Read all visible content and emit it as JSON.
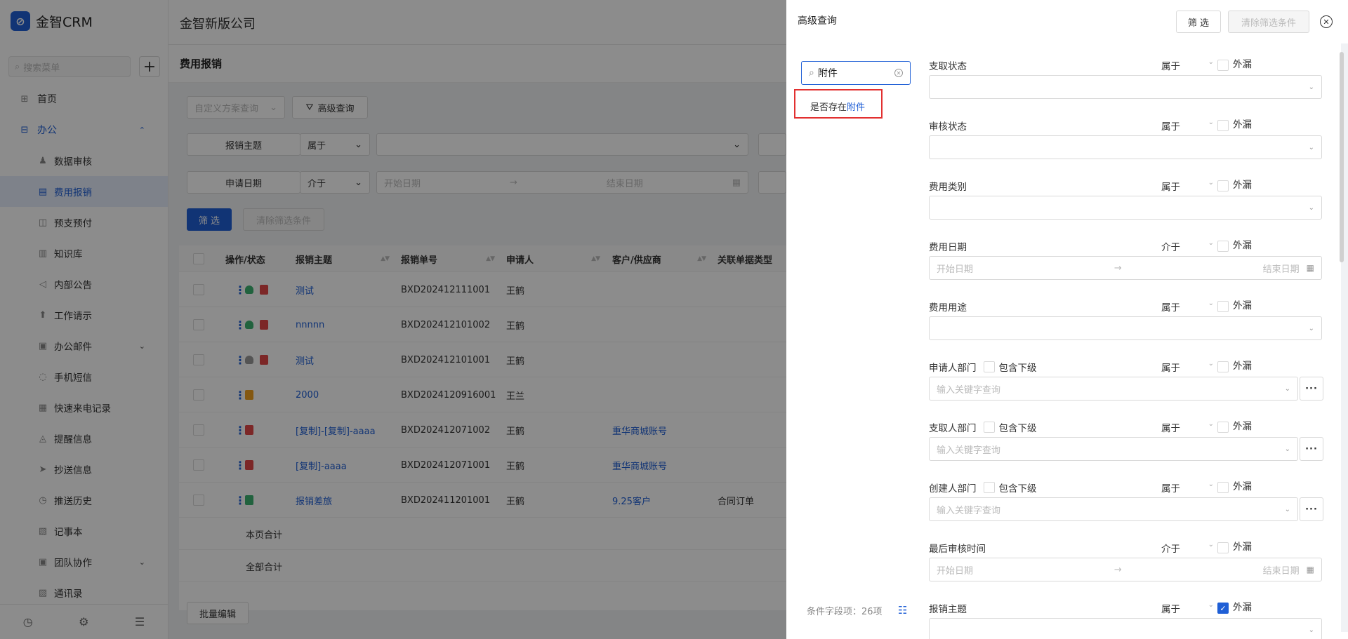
{
  "app": {
    "brand": "金智CRM",
    "company": "金智新版公司"
  },
  "sidebar": {
    "search_placeholder": "搜索菜单",
    "add_label": "+",
    "items": [
      {
        "label": "首页",
        "icon": "home-icon",
        "glyph": "⊞"
      },
      {
        "label": "办公",
        "icon": "office-icon",
        "glyph": "⊟"
      },
      {
        "label": "数据审核",
        "icon": "user-icon",
        "glyph": "♟"
      },
      {
        "label": "费用报销",
        "icon": "receipt-icon",
        "glyph": "▤"
      },
      {
        "label": "预支预付",
        "icon": "wallet-icon",
        "glyph": "◫"
      },
      {
        "label": "知识库",
        "icon": "book-icon",
        "glyph": "▥"
      },
      {
        "label": "内部公告",
        "icon": "megaphone-icon",
        "glyph": "◁"
      },
      {
        "label": "工作请示",
        "icon": "upload-icon",
        "glyph": "⬆"
      },
      {
        "label": "办公邮件",
        "icon": "mail-icon",
        "glyph": "▣"
      },
      {
        "label": "手机短信",
        "icon": "message-icon",
        "glyph": "◌"
      },
      {
        "label": "快速来电记录",
        "icon": "call-log-icon",
        "glyph": "▦"
      },
      {
        "label": "提醒信息",
        "icon": "bell-icon",
        "glyph": "◬"
      },
      {
        "label": "抄送信息",
        "icon": "send-icon",
        "glyph": "➤"
      },
      {
        "label": "推送历史",
        "icon": "clock-icon",
        "glyph": "◷"
      },
      {
        "label": "记事本",
        "icon": "notebook-icon",
        "glyph": "▧"
      },
      {
        "label": "团队协作",
        "icon": "team-icon",
        "glyph": "▣"
      },
      {
        "label": "通讯录",
        "icon": "contacts-icon",
        "glyph": "▨"
      }
    ],
    "bottom": [
      {
        "name": "history-icon",
        "glyph": "◷"
      },
      {
        "name": "settings-icon",
        "glyph": "⚙"
      },
      {
        "name": "collapse-menu-icon",
        "glyph": "☰"
      }
    ]
  },
  "page": {
    "title": "费用报销",
    "custom_query_placeholder": "自定义方案查询",
    "advanced_query_label": "高级查询",
    "filter_rows": [
      {
        "label": "报销主题",
        "op": "属于"
      },
      {
        "label": "申请日期",
        "op": "介于",
        "start_placeholder": "开始日期",
        "end_placeholder": "结束日期"
      }
    ],
    "filter_btn": "筛 选",
    "clear_btn": "清除筛选条件",
    "bulk_edit": "批量编辑"
  },
  "table": {
    "columns": [
      "操作/状态",
      "报销主题",
      "报销单号",
      "申请人",
      "客户/供应商",
      "关联单据类型"
    ],
    "rows": [
      {
        "subject": "测试",
        "no": "BXD202412111001",
        "applicant": "王鹤",
        "customer": "",
        "related": "",
        "person": "green",
        "status": "red"
      },
      {
        "subject": "nnnnn",
        "no": "BXD202412101002",
        "applicant": "王鹤",
        "customer": "",
        "related": "",
        "person": "green",
        "status": "red"
      },
      {
        "subject": "测试",
        "no": "BXD202412101001",
        "applicant": "王鹤",
        "customer": "",
        "related": "",
        "person": "gray",
        "status": "red"
      },
      {
        "subject": "2000",
        "no": "BXD2024120916001",
        "applicant": "王兰",
        "customer": "",
        "related": "",
        "person": "",
        "status": "orange"
      },
      {
        "subject": "[复制]-[复制]-aaaa",
        "no": "BXD202412071002",
        "applicant": "王鹤",
        "customer": "重华商城账号",
        "related": "",
        "person": "",
        "status": "red"
      },
      {
        "subject": "[复制]-aaaa",
        "no": "BXD202412071001",
        "applicant": "王鹤",
        "customer": "重华商城账号",
        "related": "",
        "person": "",
        "status": "red"
      },
      {
        "subject": "报销差旅",
        "no": "BXD202411201001",
        "applicant": "王鹤",
        "customer": "9.25客户",
        "related": "合同订单",
        "person": "",
        "status": "green"
      }
    ],
    "page_total": "本页合计",
    "all_total": "全部合计"
  },
  "panel": {
    "title": "高级查询",
    "filter_btn": "筛 选",
    "clear_btn": "清除筛选条件",
    "search_value": "附件",
    "result_prefix": "是否存在",
    "result_highlight": "附件",
    "count_label": "条件字段项：26项",
    "exclude_label": "外漏",
    "include_sub_label": "包含下级",
    "keyword_placeholder": "输入关键字查询",
    "start_placeholder": "开始日期",
    "end_placeholder": "结束日期",
    "fields": [
      {
        "label": "支取状态",
        "op": "属于",
        "type": "select",
        "excluded": false
      },
      {
        "label": "审核状态",
        "op": "属于",
        "type": "select",
        "excluded": false
      },
      {
        "label": "费用类别",
        "op": "属于",
        "type": "select",
        "excluded": false
      },
      {
        "label": "费用日期",
        "op": "介于",
        "type": "date",
        "excluded": false
      },
      {
        "label": "费用用途",
        "op": "属于",
        "type": "select",
        "excluded": false
      },
      {
        "label": "申请人部门",
        "op": "属于",
        "type": "dept",
        "excluded": false
      },
      {
        "label": "支取人部门",
        "op": "属于",
        "type": "dept",
        "excluded": false
      },
      {
        "label": "创建人部门",
        "op": "属于",
        "type": "dept",
        "excluded": false
      },
      {
        "label": "最后审核时间",
        "op": "介于",
        "type": "date",
        "excluded": false
      },
      {
        "label": "报销主题",
        "op": "属于",
        "type": "select",
        "excluded": true
      }
    ]
  },
  "colors": {
    "accent": "#1f5fd6",
    "highlight_border": "#e23030",
    "status_red": "#e24848",
    "status_orange": "#f0a020",
    "status_green": "#3cb371"
  }
}
